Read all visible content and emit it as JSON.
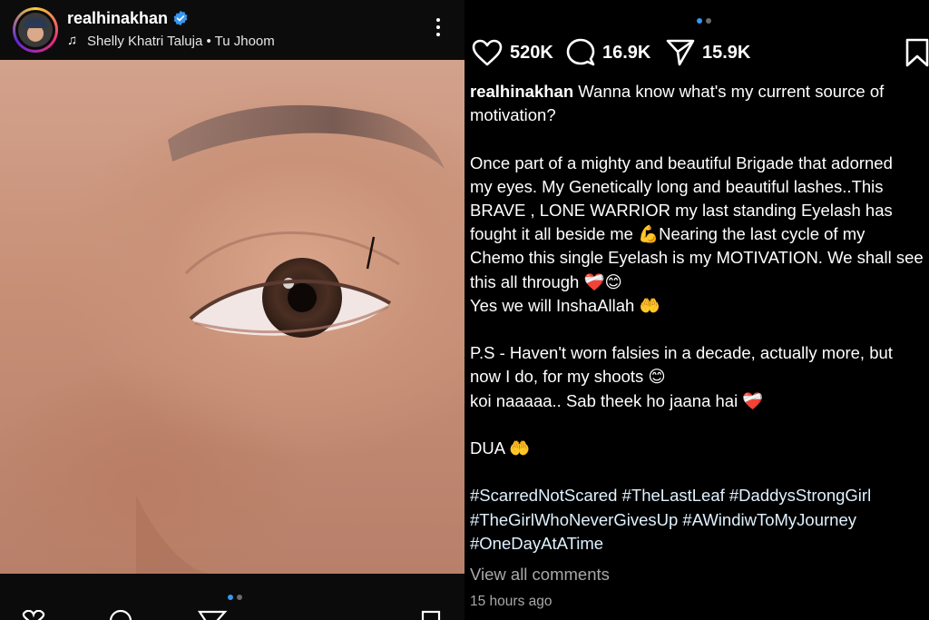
{
  "left": {
    "username": "realhinakhan",
    "song": "Shelly Khatri Taluja • Tu Jhoom",
    "icons": {
      "avatar": "profile-avatar",
      "verified": "verified-badge-icon",
      "music": "music-note-icon",
      "more": "more-options-icon",
      "mute": "muted-audio-icon"
    },
    "carousel": {
      "current": 1,
      "total": 2
    }
  },
  "right": {
    "carousel": {
      "current": 1,
      "total": 2
    },
    "likes": "520K",
    "comments": "16.9K",
    "shares": "15.9K",
    "caption": {
      "username": "realhinakhan",
      "line1": " Wanna know what's my current source of",
      "line2": "motivation?",
      "line3": "Once part of a mighty and beautiful Brigade that adorned",
      "line4": "my eyes. My Genetically long and beautiful lashes..This",
      "line5": "BRAVE , LONE WARRIOR my last standing Eyelash has",
      "line6": "fought it all beside me 💪Nearing the last cycle of my",
      "line7": "Chemo this single Eyelash is my MOTIVATION. We shall see",
      "line8": "this all through ❤️‍🩹😊",
      "line9": "Yes we will InshaAllah 🤲",
      "line10": "P.S - Haven't worn falsies in a decade, actually more, but",
      "line11": "now I do, for my shoots 😊",
      "line12": "koi naaaaa.. Sab theek ho jaana hai ❤️‍🩹",
      "line13": "DUA 🤲",
      "hashtags1": "#ScarredNotScared #TheLastLeaf #DaddysStrongGirl",
      "hashtags2": "#TheGirlWhoNeverGivesUp #AWindiwToMyJourney",
      "hashtags3": "#OneDayAtATime"
    },
    "view_comments": "View all comments",
    "timestamp": "15 hours ago"
  },
  "colors": {
    "accent": "#3797f0",
    "muted_text": "#a8a8a8",
    "hashtag": "#e0f1ff"
  }
}
